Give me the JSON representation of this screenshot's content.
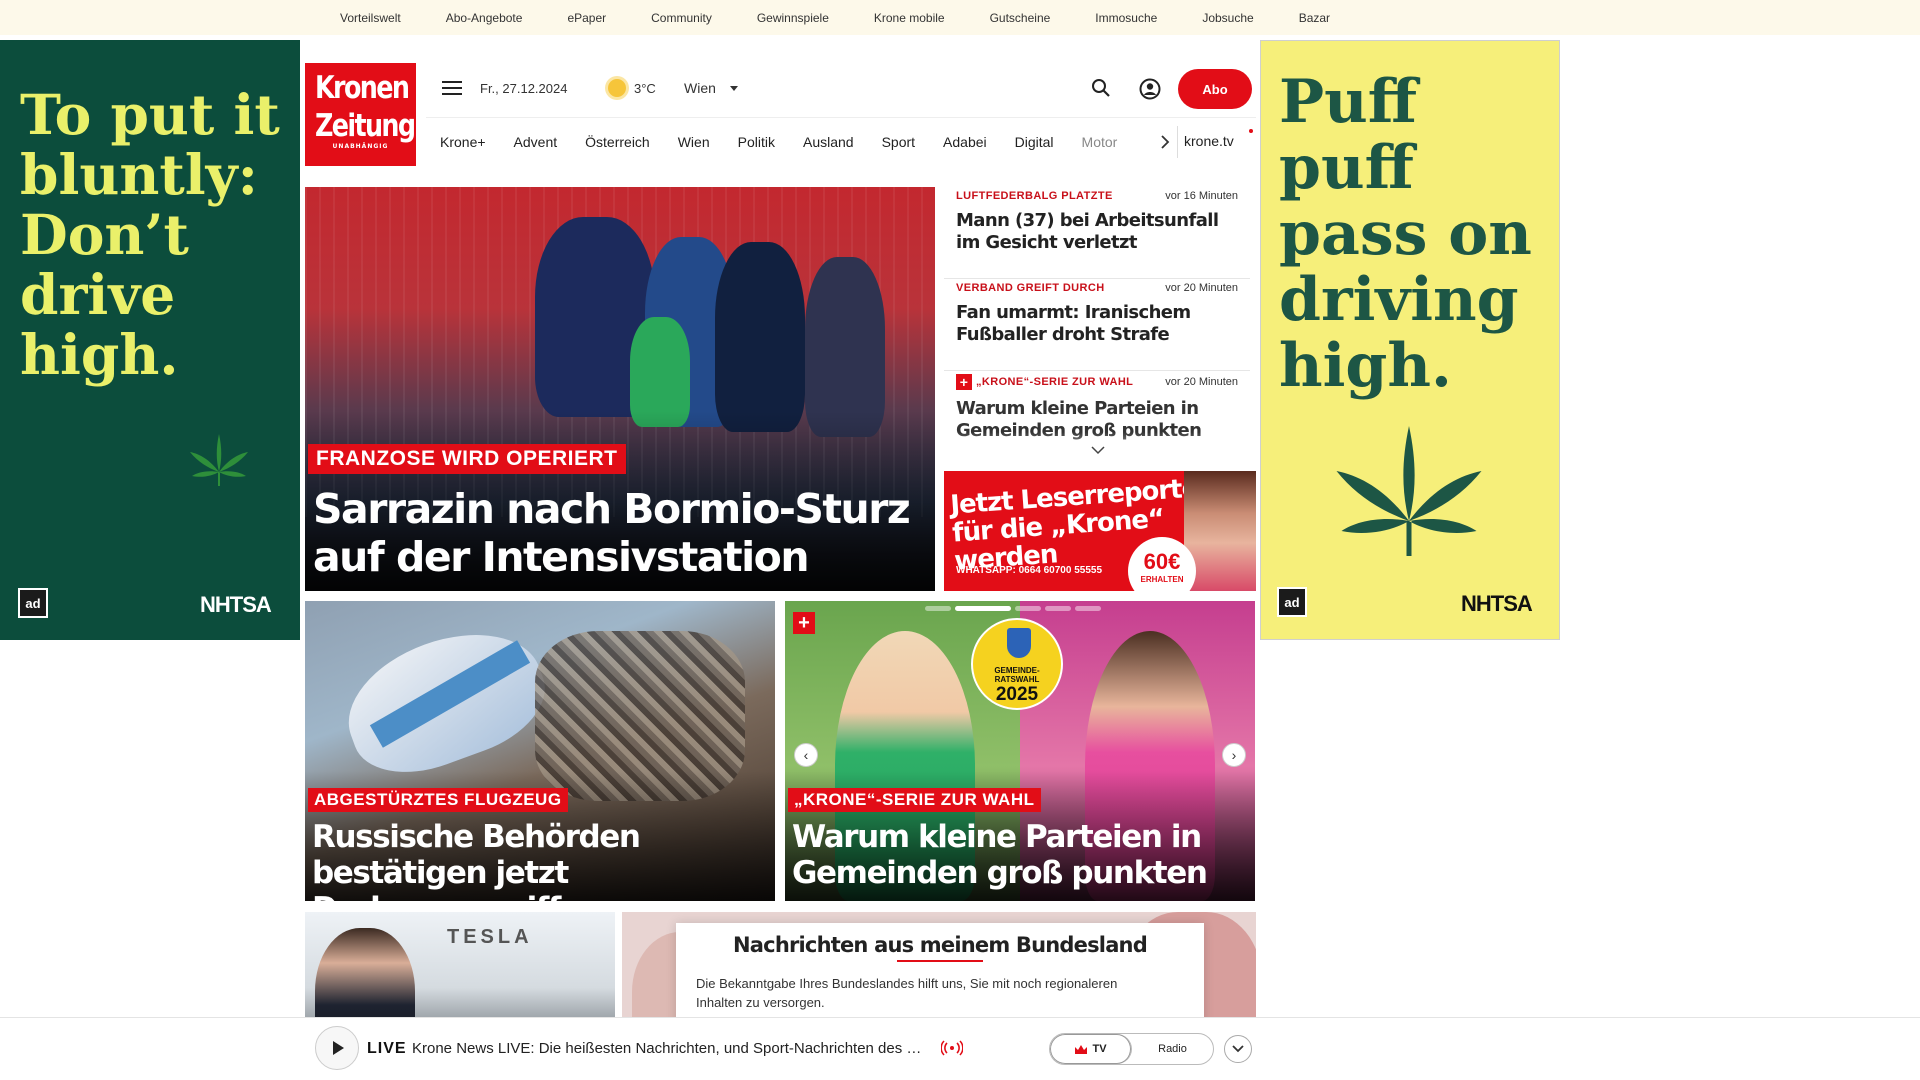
{
  "topbar": {
    "links": [
      "Vorteilswelt",
      "Abo-Angebote",
      "ePaper",
      "Community",
      "Gewinnspiele",
      "Krone mobile",
      "Gutscheine",
      "Immosuche",
      "Jobsuche",
      "Bazar"
    ]
  },
  "ad_left": {
    "slogan": "To put it bluntly: Don’t drive high.",
    "brand": "NHTSA",
    "badge": "ad",
    "bg_color": "#0c4d3c",
    "text_color": "#eaf06a"
  },
  "ad_right": {
    "slogan": "Puff puff pass on driving high.",
    "brand": "NHTSA",
    "badge": "ad",
    "bg_color": "#f6ef7a",
    "text_color": "#1d5645"
  },
  "header": {
    "logo_line1": "Kronen",
    "logo_line2": "Zeitung",
    "logo_tagline": "UNABHÄNGIG",
    "date": "Fr., 27.12.2024",
    "temperature": "3°C",
    "region": "Wien",
    "abo_label": "Abo",
    "accent_color": "#e20d17"
  },
  "nav": {
    "items": [
      "Krone+",
      "Advent",
      "Österreich",
      "Wien",
      "Politik",
      "Ausland",
      "Sport",
      "Adabei",
      "Digital",
      "Motor"
    ],
    "tv_label": "krone.tv"
  },
  "hero": {
    "kicker": "FRANZOSE WIRD OPERIERT",
    "headline": "Sarrazin nach Bormio-Sturz auf der Intensivstation"
  },
  "news": [
    {
      "kicker": "LUFTFEDERBALG PLATZTE",
      "time": "vor 16 Minuten",
      "title": "Mann (37) bei Arbeitsunfall im Gesicht verletzt",
      "plus": false
    },
    {
      "kicker": "VERBAND GREIFT DURCH",
      "time": "vor 20 Minuten",
      "title": "Fan umarmt: Iranischem Fußballer droht Strafe",
      "plus": false
    },
    {
      "kicker": "„KRONE“-SERIE ZUR WAHL",
      "time": "vor 20 Minuten",
      "title": "Warum kleine Parteien in Gemeinden groß punkten",
      "plus": true
    }
  ],
  "reporter_ad": {
    "headline_1": "Jetzt Leserreporter",
    "headline_2": "für die „Krone“ werden",
    "whatsapp": "WHATSAPP: 0664 60700 55555",
    "badge_amount": "60€",
    "badge_sub": "ERHALTEN"
  },
  "cards": {
    "plane": {
      "kicker": "ABGESTÜRZTES FLUGZEUG",
      "headline": "Russische Behörden bestätigen jetzt Drohnenangriff"
    },
    "wahl": {
      "kicker": "„KRONE“-SERIE ZUR WAHL",
      "headline": "Warum kleine Parteien in Gemeinden groß punkten",
      "seal_line1": "GEMEINDE-",
      "seal_line2": "RATSWAHL",
      "seal_year": "2025"
    },
    "tesla": {
      "sign": "TESLA"
    }
  },
  "region_popup": {
    "title": "Nachrichten aus meinem Bundesland",
    "text": "Die Bekanntgabe Ihres Bundeslandes hilft uns, Sie mit noch regionaleren Inhalten zu versorgen."
  },
  "player": {
    "live_label": "LIVE",
    "live_text": "Krone News LIVE: Die heißesten Nachrichten, und Sport-Nachrichten des …",
    "tv_label": "TV",
    "radio_label": "Radio"
  }
}
